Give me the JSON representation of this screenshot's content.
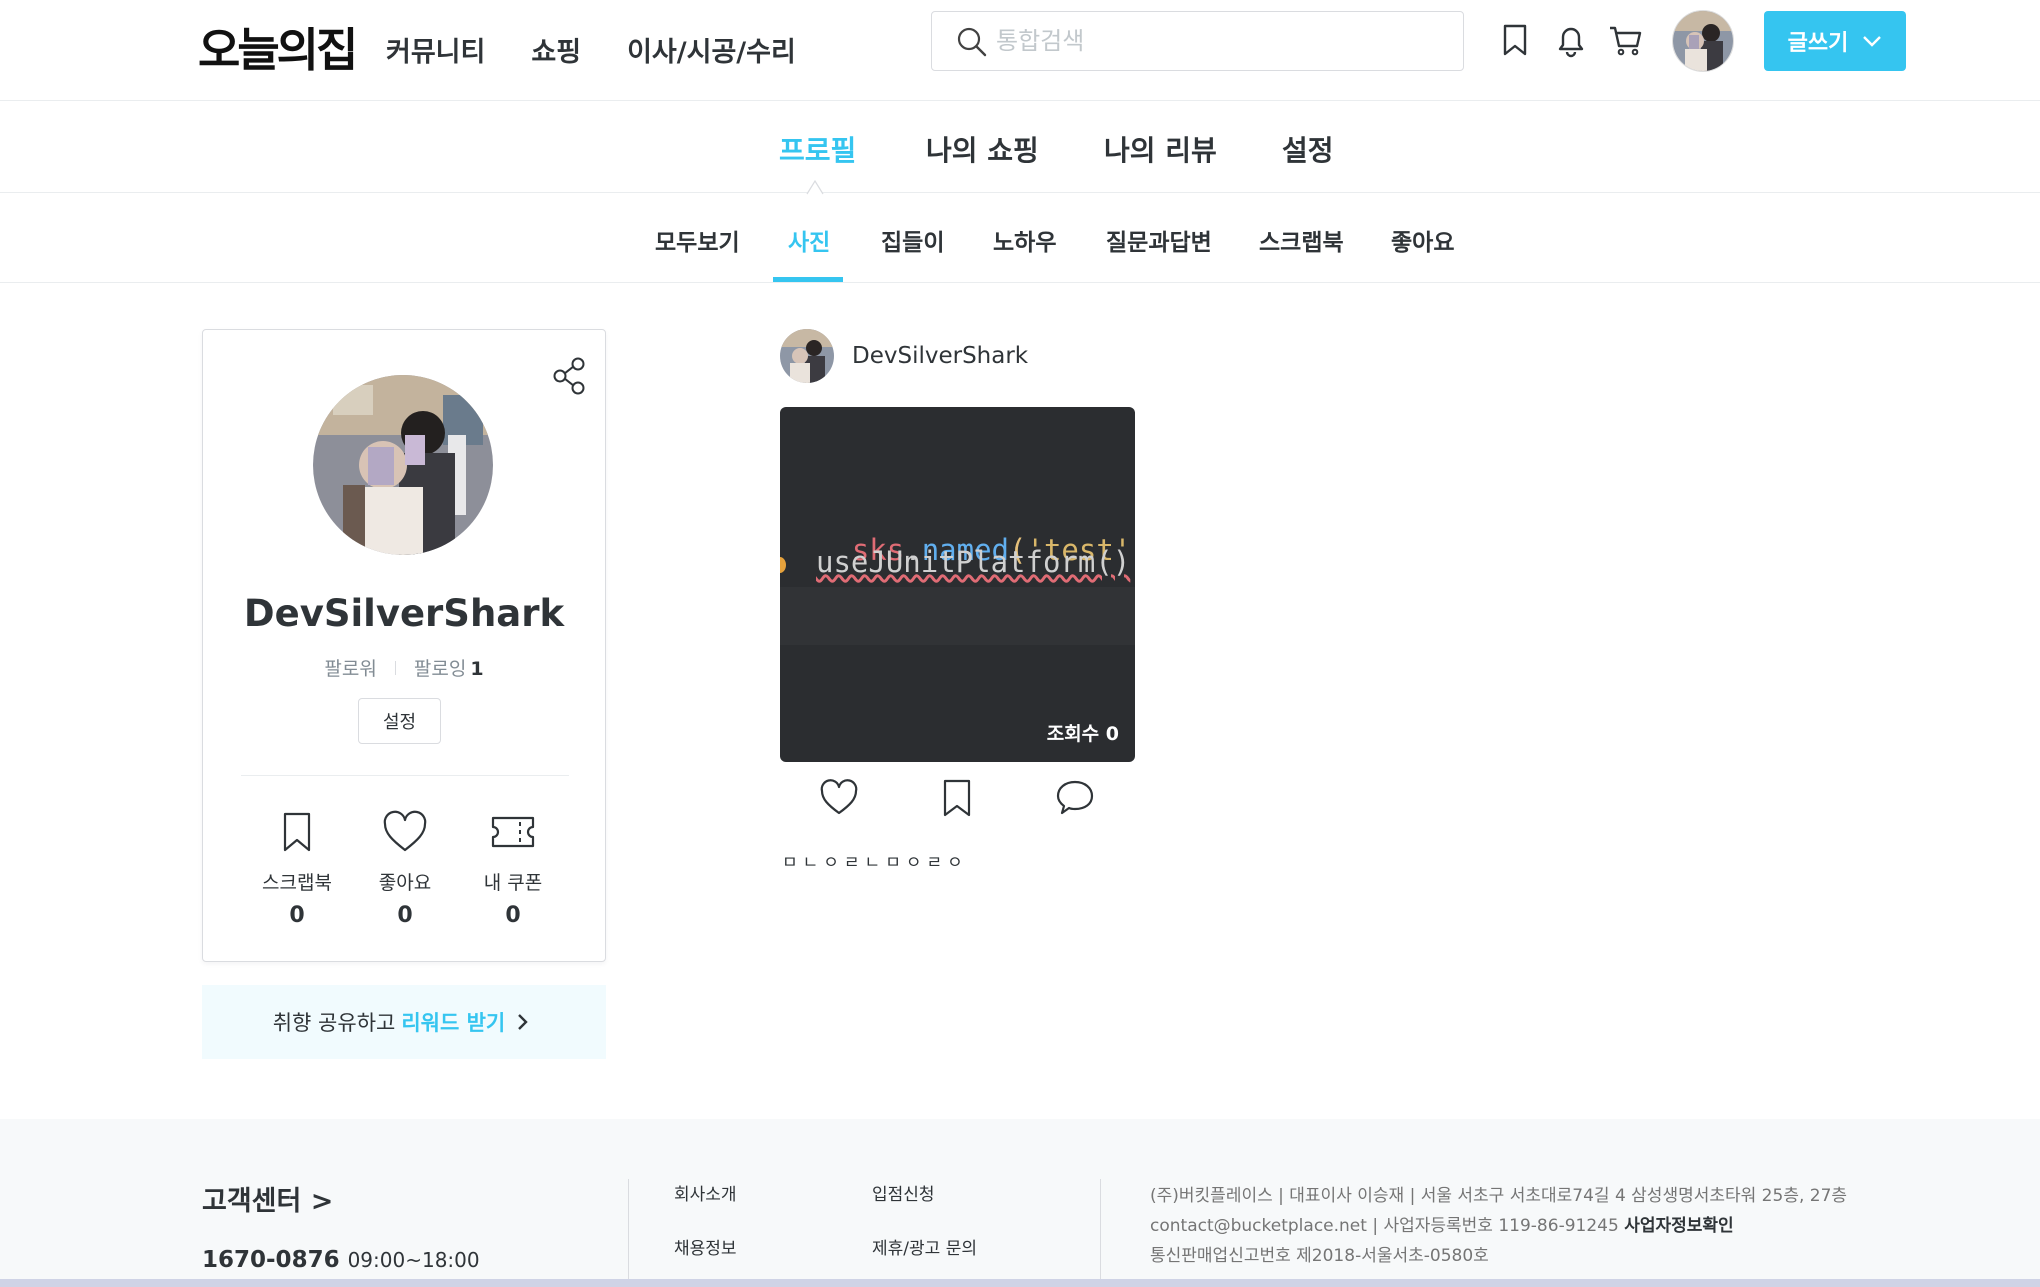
{
  "header": {
    "logo": "오늘의집",
    "nav": [
      "커뮤니티",
      "쇼핑",
      "이사/시공/수리"
    ],
    "search_placeholder": "통합검색",
    "write_button": "글쓰기"
  },
  "profile_tabs": [
    "프로필",
    "나의 쇼핑",
    "나의 리뷰",
    "설정"
  ],
  "content_tabs": [
    "모두보기",
    "사진",
    "집들이",
    "노하우",
    "질문과답변",
    "스크랩북",
    "좋아요"
  ],
  "profile": {
    "username": "DevSilverShark",
    "follower_label": "팔로워",
    "following_label": "팔로잉",
    "following_count": "1",
    "settings_button": "설정",
    "stats": [
      {
        "label": "스크랩북",
        "count": "0",
        "icon": "bookmark-icon"
      },
      {
        "label": "좋아요",
        "count": "0",
        "icon": "heart-icon"
      },
      {
        "label": "내 쿠폰",
        "count": "0",
        "icon": "coupon-icon"
      }
    ]
  },
  "reward": {
    "text": "취향 공유하고",
    "highlight": "리워드 받기"
  },
  "post": {
    "author": "DevSilverShark",
    "code_line1": {
      "a": "sks",
      "b": ".",
      "c": "named",
      "d": "(",
      "e": "'test'",
      "f": ") {"
    },
    "code_line2": "useJUnitPlatform()",
    "views": "조회수 0",
    "caption": "ㅁㄴㅇㄹㄴㅁㅇㄹㅇ"
  },
  "footer": {
    "cs_title": "고객센터 >",
    "phone": "1670-0876",
    "hours": "09:00~18:00",
    "links": [
      "회사소개",
      "입점신청",
      "채용정보",
      "제휴/광고 문의"
    ],
    "info_line1": "(주)버킷플레이스 | 대표이사 이승재 | 서울 서초구 서초대로74길 4 삼성생명서초타워 25층, 27층",
    "info_line2_prefix": "contact@bucketplace.net | 사업자등록번호 119-86-91245",
    "info_line2_bold": "사업자정보확인",
    "info_line3": "통신판매업신고번호 제2018-서울서초-0580호"
  },
  "colors": {
    "accent": "#35c5f0",
    "text": "#2f3438",
    "muted": "#828c94",
    "code_bg": "#2b2d30"
  }
}
